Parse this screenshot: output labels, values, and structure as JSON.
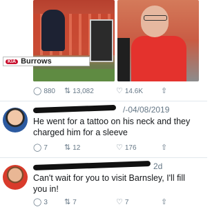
{
  "main_tweet": {
    "board_text": "Burrows",
    "kia_text": "KIA",
    "replies": "880",
    "retweets": "13,082",
    "likes": "14.6K"
  },
  "replies": [
    {
      "date": "/-04/08/2019",
      "text": "He went for a tattoo on his neck and they charged him for a sleeve",
      "replies": "7",
      "retweets": "12",
      "likes": "176"
    },
    {
      "date": "2d",
      "text": "Can't wait for you to visit Barnsley, I'll fill you in!",
      "replies": "3",
      "retweets": "7",
      "likes": "7"
    }
  ]
}
